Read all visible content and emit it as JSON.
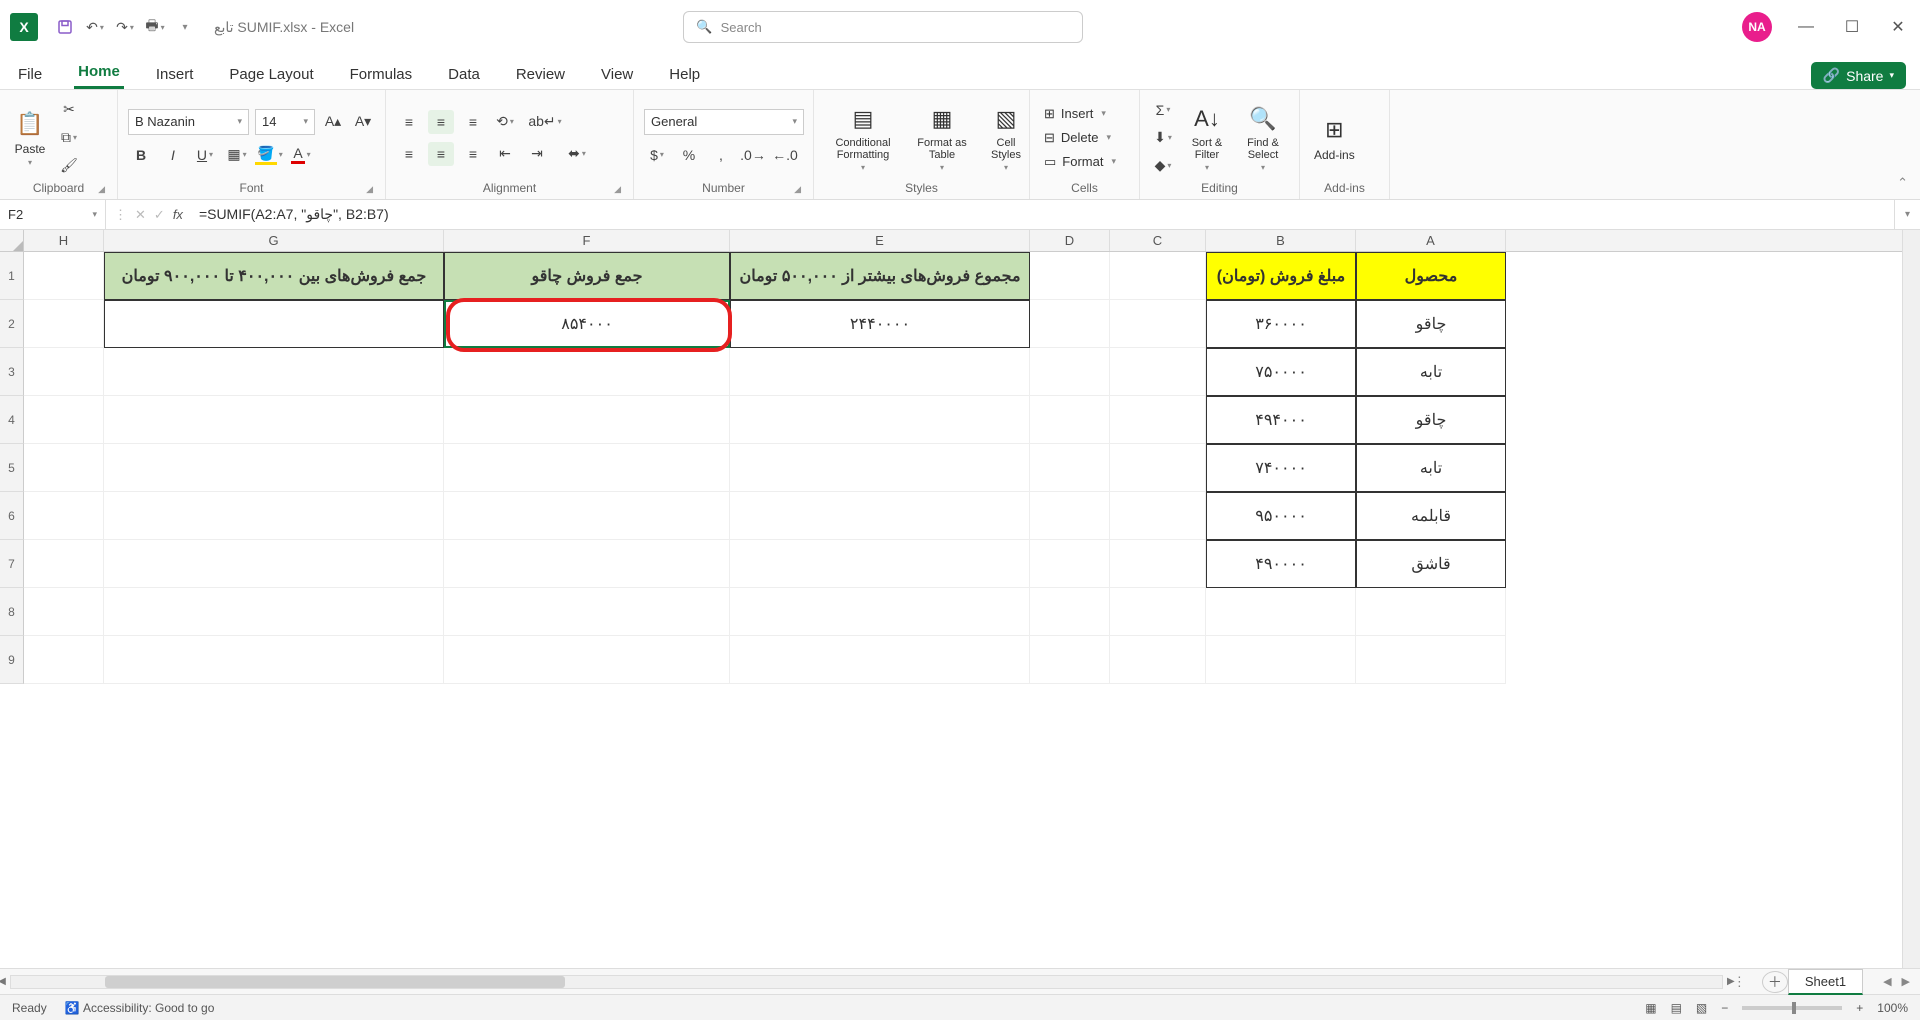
{
  "titlebar": {
    "filename": "تابع SUMIF.xlsx  -  Excel",
    "search_placeholder": "Search",
    "avatar": "NA"
  },
  "tabs": {
    "file": "File",
    "home": "Home",
    "insert": "Insert",
    "pagelayout": "Page Layout",
    "formulas": "Formulas",
    "data": "Data",
    "review": "Review",
    "view": "View",
    "help": "Help",
    "share": "Share"
  },
  "ribbon": {
    "clipboard": {
      "label": "Clipboard",
      "paste": "Paste"
    },
    "font": {
      "label": "Font",
      "name": "B Nazanin",
      "size": "14"
    },
    "alignment": {
      "label": "Alignment"
    },
    "number": {
      "label": "Number",
      "format": "General"
    },
    "styles": {
      "label": "Styles",
      "cond": "Conditional Formatting",
      "table": "Format as Table",
      "cell": "Cell Styles"
    },
    "cells": {
      "label": "Cells",
      "insert": "Insert",
      "delete": "Delete",
      "format": "Format"
    },
    "editing": {
      "label": "Editing",
      "sort": "Sort & Filter",
      "find": "Find & Select"
    },
    "addins": {
      "label": "Add-ins",
      "btn": "Add-ins"
    }
  },
  "fbar": {
    "name": "F2",
    "formula": "=SUMIF(A2:A7, \"چاقو\", B2:B7)"
  },
  "cols": [
    "H",
    "G",
    "F",
    "E",
    "D",
    "C",
    "B",
    "A"
  ],
  "headers": {
    "A": "محصول",
    "B": "مبلغ فروش (تومان)",
    "E": "مجموع فروش‌های بیشتر از ۵۰۰,۰۰۰ تومان",
    "F": "جمع فروش چاقو",
    "G": "جمع فروش‌های بین ۴۰۰,۰۰۰ تا ۹۰۰,۰۰۰ تومان"
  },
  "results": {
    "E": "۲۴۴۰۰۰۰",
    "F": "۸۵۴۰۰۰"
  },
  "table": [
    {
      "A": "چاقو",
      "B": "۳۶۰۰۰۰"
    },
    {
      "A": "تابه",
      "B": "۷۵۰۰۰۰"
    },
    {
      "A": "چاقو",
      "B": "۴۹۴۰۰۰"
    },
    {
      "A": "تابه",
      "B": "۷۴۰۰۰۰"
    },
    {
      "A": "قابلمه",
      "B": "۹۵۰۰۰۰"
    },
    {
      "A": "قاشق",
      "B": "۴۹۰۰۰۰"
    }
  ],
  "sheet": {
    "name": "Sheet1"
  },
  "status": {
    "ready": "Ready",
    "access": "Accessibility: Good to go",
    "zoom": "100%"
  }
}
